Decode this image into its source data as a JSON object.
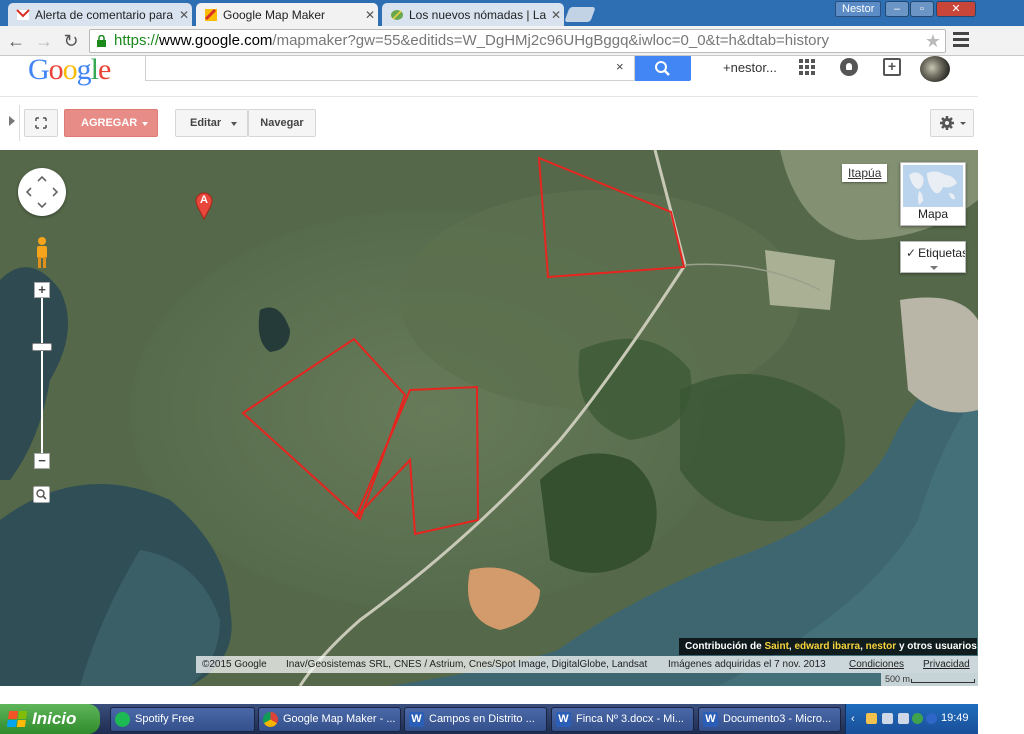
{
  "browser": {
    "tabs": [
      {
        "title": "Alerta de comentario para Te",
        "icon": "gmail-icon",
        "active": false
      },
      {
        "title": "Google Map Maker",
        "icon": "mapmaker-icon",
        "active": true
      },
      {
        "title": "Los nuevos nómadas | La Bi",
        "icon": "leaf-icon",
        "active": false
      }
    ],
    "user_badge": "Nestor",
    "window_controls": {
      "minimize": "–",
      "maximize": "▫",
      "close": "✕"
    },
    "url": {
      "scheme": "https://",
      "host": "www.google.com",
      "path": "/mapmaker?gw=55&editids=W_DgHMj2c96UHgBggq&iwloc=0_0&t=h&dtab=history"
    }
  },
  "google_header": {
    "logo_letters": [
      "G",
      "o",
      "o",
      "g",
      "l",
      "e"
    ],
    "logo_colors": [
      "#4285f4",
      "#ea4335",
      "#fbbc05",
      "#4285f4",
      "#34a853",
      "#ea4335"
    ],
    "search_value": "",
    "search_clear": "×",
    "account_name": "+nestor..."
  },
  "mapmaker_toolbar": {
    "add_label": "AGREGAR",
    "edit_label": "Editar",
    "navigate_label": "Navegar"
  },
  "map": {
    "marker_label": "A",
    "region_label": "Itapúa",
    "map_type_label": "Mapa",
    "labels_check": "✓",
    "labels_toggle": "Etiquetas",
    "zoom_in": "+",
    "zoom_out": "−",
    "contribution": {
      "prefix": "Contribución de ",
      "users": [
        "Saint",
        "edward ibarra",
        "nestor"
      ],
      "sep1": ", ",
      "sep2": ", ",
      "suffix": " y otros usuarios"
    },
    "attribution": {
      "copyright": "©2015 Google",
      "providers": "Inav/Geosistemas SRL, CNES / Astrium, Cnes/Spot Image, DigitalGlobe, Landsat",
      "imagery_date": "Imágenes adquiridas el 7 nov. 2013",
      "terms": "Condiciones",
      "privacy": "Privacidad"
    },
    "scale_label": "500 m",
    "parcel_outline_color": "#e8241f"
  },
  "taskbar": {
    "start_label": "Inicio",
    "items": [
      {
        "label": "Spotify Free",
        "icon": "spotify-icon"
      },
      {
        "label": "Google Map Maker - ...",
        "icon": "chrome-icon"
      },
      {
        "label": "Campos en Distrito ...",
        "icon": "word-icon"
      },
      {
        "label": "Finca Nº 3.docx - Mi...",
        "icon": "word-icon"
      },
      {
        "label": "Documento3 - Micro...",
        "icon": "word-icon"
      }
    ],
    "word_glyph": "W",
    "tray_arrow": "‹",
    "clock": "19:49"
  }
}
